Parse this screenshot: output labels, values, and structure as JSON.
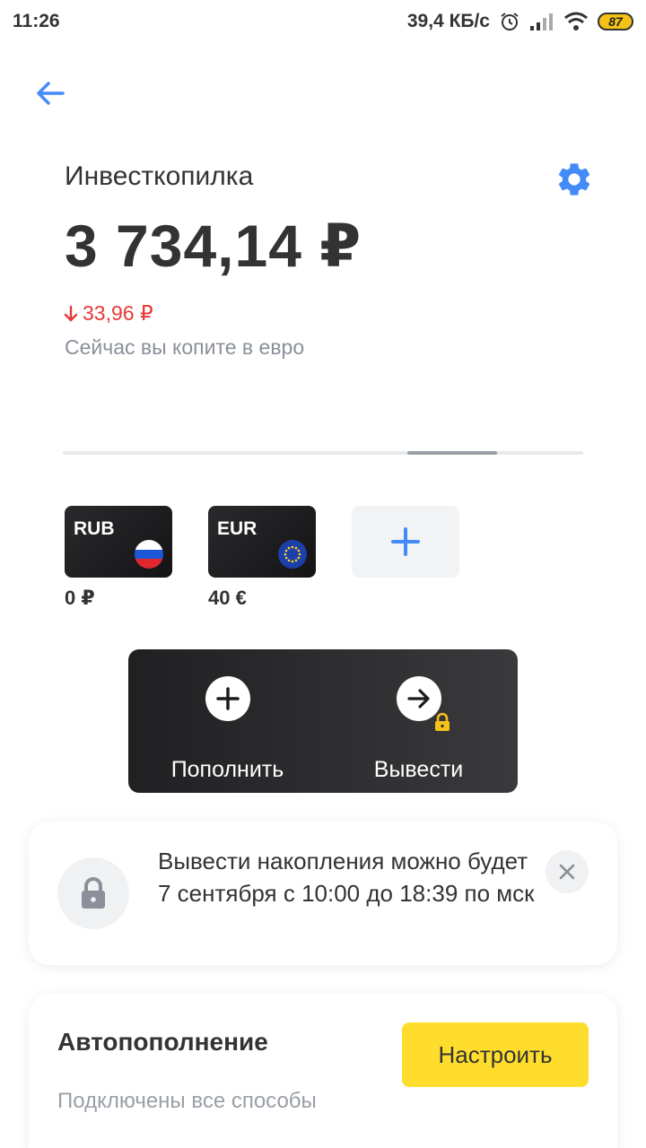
{
  "status_bar": {
    "time": "11:26",
    "network_speed": "39,4 КБ/с",
    "battery": "87",
    "icons": [
      "alarm-icon",
      "signal-icon",
      "wifi-icon",
      "battery-icon"
    ]
  },
  "header": {
    "title": "Инвесткопилка",
    "back_icon": "arrow-left-icon",
    "settings_icon": "gear-icon"
  },
  "balance": {
    "amount": "3 734,14 ₽",
    "change": "33,96 ₽",
    "change_direction": "down",
    "note": "Сейчас вы копите в евро"
  },
  "carousel": {
    "pages": 5,
    "active_page": 4
  },
  "currencies": [
    {
      "code": "RUB",
      "balance": "0 ₽",
      "flag": "russia-flag-icon"
    },
    {
      "code": "EUR",
      "balance": "40 €",
      "flag": "eu-flag-icon"
    }
  ],
  "add_currency_icon": "plus-icon",
  "actions": {
    "deposit_label": "Пополнить",
    "withdraw_label": "Вывести",
    "withdraw_locked": true
  },
  "notice": {
    "text": "Вывести накопления можно будет 7 сентября с 10:00 до 18:39 по мск",
    "icon": "lock-icon",
    "close_icon": "close-icon"
  },
  "autofill": {
    "title": "Автопополнение",
    "subtitle": "Подключены все способы",
    "button_label": "Настроить"
  },
  "colors": {
    "accent_blue": "#428bf9",
    "negative_red": "#e53935",
    "brand_yellow": "#ffdd2d",
    "dark_card": "#1c1c1e"
  }
}
